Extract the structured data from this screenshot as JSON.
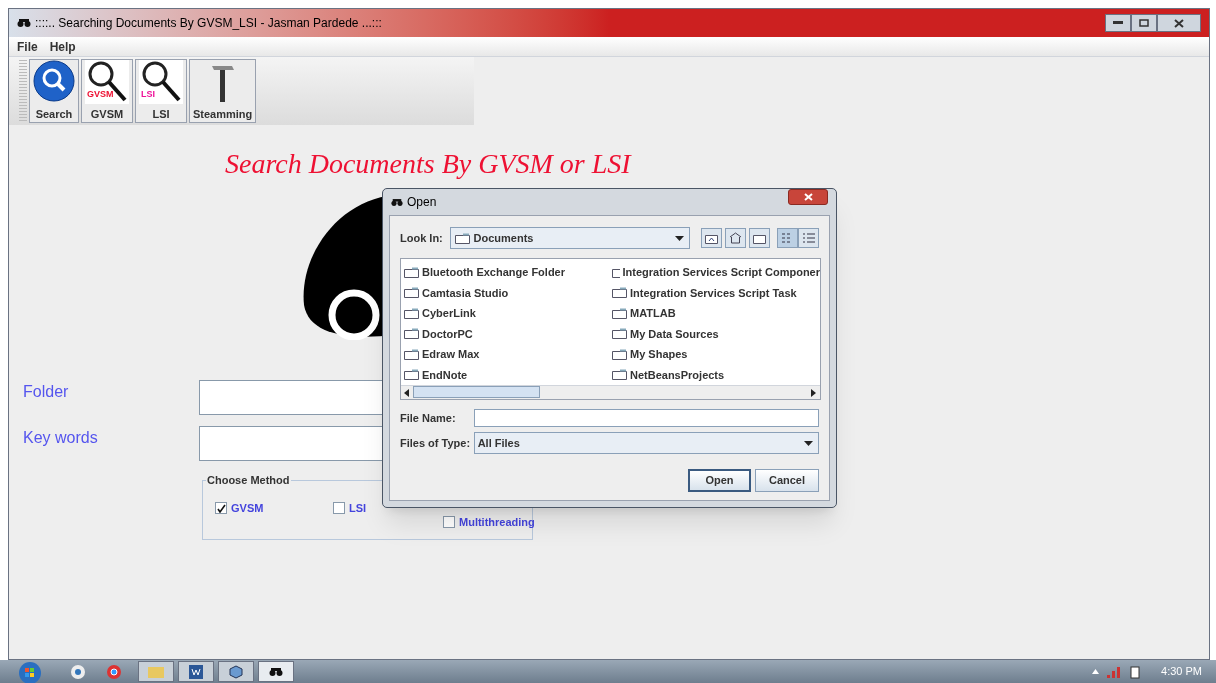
{
  "window": {
    "title": "::::.. Searching Documents By GVSM_LSI - Jasman Pardede ...:::"
  },
  "menu": [
    "File",
    "Help"
  ],
  "toolbar": [
    {
      "label": "Search",
      "kind": "search"
    },
    {
      "label": "GVSM",
      "kind": "keyword",
      "badge": "GVSM",
      "color": "#ee1133"
    },
    {
      "label": "LSI",
      "kind": "keyword",
      "badge": "LSI",
      "color": "#ee1199"
    },
    {
      "label": "Steamming",
      "kind": "hammer"
    }
  ],
  "heading": "Search Documents By GVSM or LSI",
  "fields": [
    {
      "label": "Folder"
    },
    {
      "label": "Key words"
    }
  ],
  "method_group": {
    "title": "Choose Method",
    "options": [
      {
        "label": "GVSM",
        "checked": true
      },
      {
        "label": "LSI",
        "checked": false
      },
      {
        "label": "Multithreading",
        "checked": false
      }
    ]
  },
  "dialog": {
    "title": "Open",
    "look_in_label": "Look In:",
    "look_in": "Documents",
    "files": [
      "Bluetooth Exchange Folder",
      "Camtasia Studio",
      "CyberLink",
      "DoctorPC",
      "Edraw Max",
      "EndNote",
      "Integration Services Script Componer",
      "Integration Services Script Task",
      "MATLAB",
      "My Data Sources",
      "My Shapes",
      "NetBeansProjects"
    ],
    "file_name_label": "File Name:",
    "file_type_label": "Files of Type:",
    "file_type": "All Files",
    "buttons": [
      "Open",
      "Cancel"
    ]
  },
  "taskbar": {
    "time": "4:30 PM"
  }
}
